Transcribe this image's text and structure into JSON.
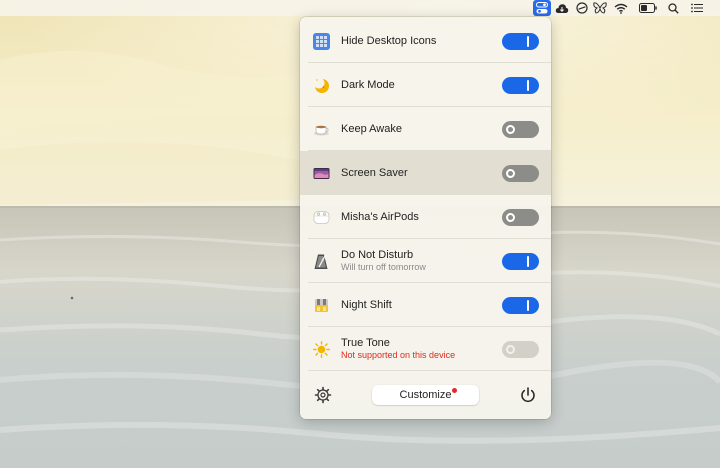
{
  "menubar": {
    "icons": [
      "one-switch-icon",
      "cloud-download-icon",
      "do-not-disturb-icon",
      "butterfly-icon",
      "wifi-icon",
      "battery-icon",
      "spotlight-search-icon",
      "notification-center-icon"
    ],
    "active_color": "#2a6bea"
  },
  "panel": {
    "rows": [
      {
        "label": "Hide Desktop Icons",
        "sublabel": "",
        "state": "on",
        "icon": "grid-icon"
      },
      {
        "label": "Dark Mode",
        "sublabel": "",
        "state": "on",
        "icon": "moon-icon"
      },
      {
        "label": "Keep Awake",
        "sublabel": "",
        "state": "off",
        "icon": "coffee-cup-icon"
      },
      {
        "label": "Screen Saver",
        "sublabel": "",
        "state": "off",
        "icon": "screen-saver-icon",
        "highlighted": true
      },
      {
        "label": "Misha's AirPods",
        "sublabel": "",
        "state": "off",
        "icon": "airpods-icon"
      },
      {
        "label": "Do Not Disturb",
        "sublabel": "Will turn off tomorrow",
        "state": "on",
        "icon": "metronome-icon"
      },
      {
        "label": "Night Shift",
        "sublabel": "",
        "state": "on",
        "icon": "night-shift-icon"
      },
      {
        "label": "True Tone",
        "sublabel": "Not supported on this device",
        "state": "disabled",
        "icon": "sun-icon",
        "sublabel_warning": true
      }
    ],
    "footer": {
      "customize_label": "Customize",
      "settings_icon": "gear-icon",
      "power_icon": "power-icon",
      "customize_badge": true
    }
  },
  "colors": {
    "toggle_on": "#1a67e8",
    "toggle_off": "#8c8c88",
    "warning": "#e02a1d",
    "badge": "#e8262a"
  }
}
